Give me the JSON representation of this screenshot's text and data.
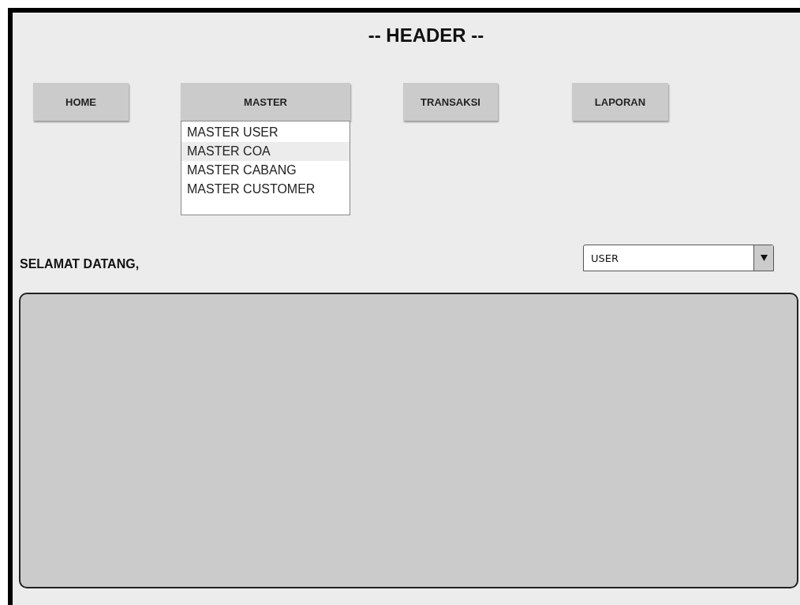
{
  "header": {
    "title": "-- HEADER --"
  },
  "menu": [
    {
      "label": "HOME",
      "expanded": false
    },
    {
      "label": "MASTER",
      "expanded": true,
      "items": [
        {
          "label": "MASTER USER",
          "selected": false
        },
        {
          "label": "MASTER COA",
          "selected": true
        },
        {
          "label": "MASTER CABANG",
          "selected": false
        },
        {
          "label": "MASTER CUSTOMER",
          "selected": false
        }
      ]
    },
    {
      "label": "TRANSAKSI",
      "expanded": false
    },
    {
      "label": "LAPORAN",
      "expanded": false
    }
  ],
  "welcome": "SELAMAT DATANG,",
  "user_select": {
    "value": "USER"
  }
}
